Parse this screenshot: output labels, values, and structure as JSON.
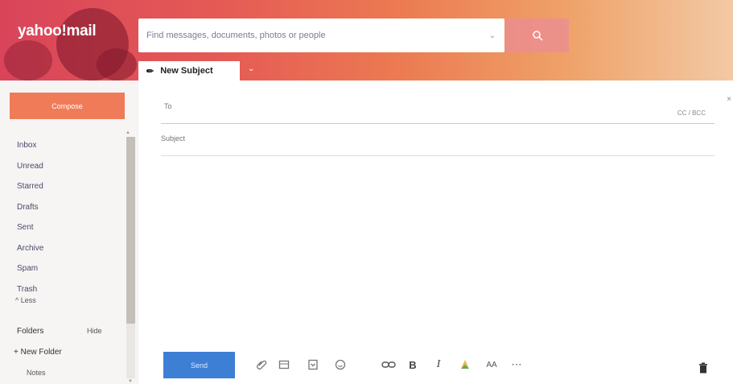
{
  "brand": {
    "logo_text": "yahoo!mail"
  },
  "search": {
    "placeholder": "Find messages, documents, photos or people"
  },
  "tab": {
    "title": "New Subject"
  },
  "sidebar": {
    "compose_label": "Compose",
    "folders": [
      "Inbox",
      "Unread",
      "Starred",
      "Drafts",
      "Sent",
      "Archive",
      "Spam",
      "Trash"
    ],
    "less_label": "^ Less",
    "folders_heading": "Folders",
    "hide_label": "Hide",
    "new_folder_label": "+ New Folder",
    "notes_label": "Notes"
  },
  "compose": {
    "to_label": "To",
    "cc_bcc_label": "CC / BCC",
    "subject_placeholder": "Subject",
    "send_label": "Send"
  },
  "colors": {
    "compose_button": "#ef7b59",
    "send_button": "#3e7fd6",
    "to_underline": "#a9d3e6"
  },
  "icons": [
    "attachment-icon",
    "photo-icon",
    "sticker-icon",
    "emoji-icon",
    "link-icon",
    "bold-icon",
    "italic-icon",
    "text-color-icon",
    "font-size-icon",
    "more-icon",
    "trash-icon"
  ]
}
